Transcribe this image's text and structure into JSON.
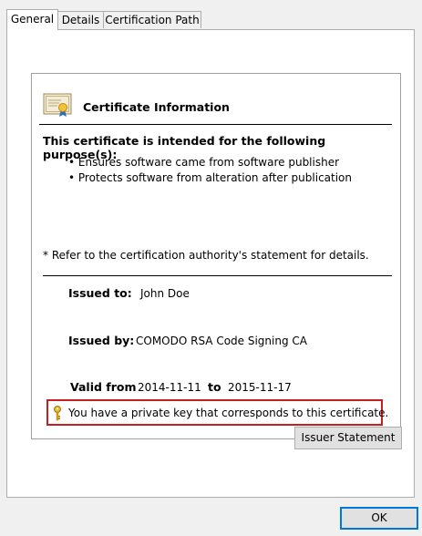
{
  "tabs": [
    "General",
    "Details",
    "Certification Path"
  ],
  "info": {
    "title": "Certificate Information",
    "purpose_heading": "This certificate is intended for the following purpose(s):",
    "purposes": [
      "Ensures software came from software publisher",
      "Protects software from alteration after publication"
    ],
    "refer_note": "* Refer to the certification authority's statement for details.",
    "issued_to_label": "Issued to:",
    "issued_to_value": "John Doe",
    "issued_by_label": "Issued by:",
    "issued_by_value": "COMODO RSA Code Signing CA",
    "valid_from_label": "Valid from",
    "valid_from_value": "2014-11-11",
    "valid_to_label": "to",
    "valid_to_value": "2015-11-17",
    "private_key_note": "You have a private key that corresponds to this certificate."
  },
  "buttons": {
    "issuer_statement": "Issuer Statement",
    "ok": "OK"
  },
  "colors": {
    "highlight_border": "#c81e1e",
    "default_button_border": "#0078d7"
  }
}
